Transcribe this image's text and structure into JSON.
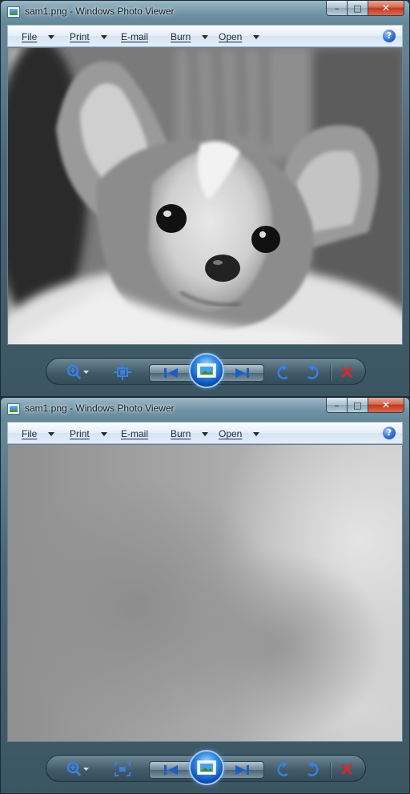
{
  "windows": [
    {
      "title": "sam1.png - Windows Photo Viewer",
      "menu": [
        {
          "label": "File",
          "has_dropdown": true
        },
        {
          "label": "Print",
          "has_dropdown": true
        },
        {
          "label": "E-mail",
          "has_dropdown": false
        },
        {
          "label": "Burn",
          "has_dropdown": true
        },
        {
          "label": "Open",
          "has_dropdown": true
        }
      ],
      "help_glyph": "?",
      "image_description_icon": "photo-dog-chihuahua-grayscale"
    },
    {
      "title": "sam1.png - Windows Photo Viewer",
      "menu": [
        {
          "label": "File",
          "has_dropdown": true
        },
        {
          "label": "Print",
          "has_dropdown": true
        },
        {
          "label": "E-mail",
          "has_dropdown": false
        },
        {
          "label": "Burn",
          "has_dropdown": true
        },
        {
          "label": "Open",
          "has_dropdown": true
        }
      ],
      "help_glyph": "?",
      "image_description_icon": "photo-blurred-grayscale"
    }
  ],
  "caption_buttons": {
    "minimize": "–",
    "maximize": "□",
    "close": "✕"
  },
  "colors": {
    "accent_blue": "#2f6fd3",
    "delete_red": "#d42a2a",
    "menu_bg": "#e4eef8"
  }
}
